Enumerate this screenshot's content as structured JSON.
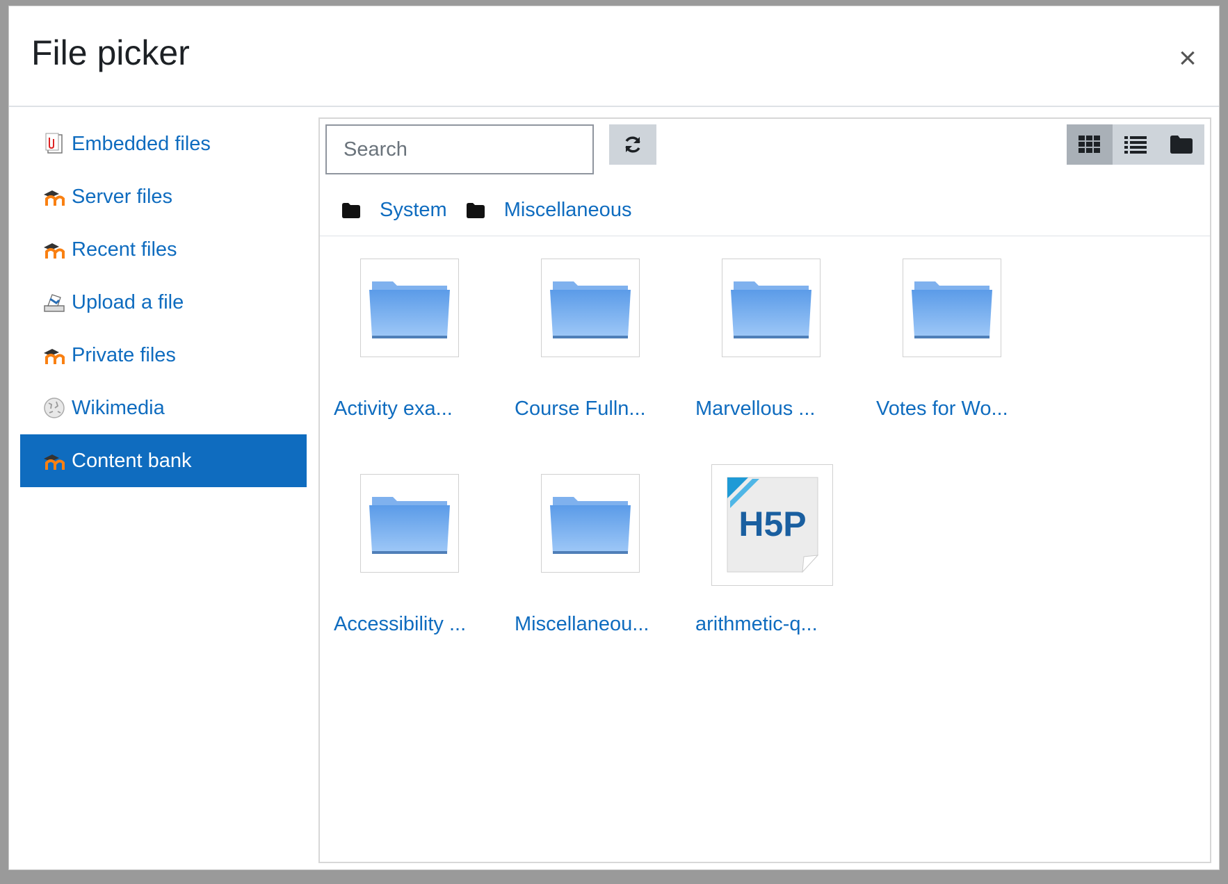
{
  "modal": {
    "title": "File picker",
    "close_symbol": "×"
  },
  "sidebar": {
    "items": [
      {
        "label": "Embedded files",
        "icon": "embedded-files-icon",
        "active": false
      },
      {
        "label": "Server files",
        "icon": "moodle-icon",
        "active": false
      },
      {
        "label": "Recent files",
        "icon": "moodle-icon",
        "active": false
      },
      {
        "label": "Upload a file",
        "icon": "upload-icon",
        "active": false
      },
      {
        "label": "Private files",
        "icon": "moodle-icon",
        "active": false
      },
      {
        "label": "Wikimedia",
        "icon": "wikimedia-icon",
        "active": false
      },
      {
        "label": "Content bank",
        "icon": "moodle-icon",
        "active": true
      }
    ]
  },
  "toolbar": {
    "search_placeholder": "Search",
    "refresh_icon": "refresh-icon",
    "views": [
      {
        "name": "icons-view",
        "active": true
      },
      {
        "name": "list-view",
        "active": false
      },
      {
        "name": "tree-view",
        "active": false
      }
    ]
  },
  "breadcrumb": [
    "System",
    "Miscellaneous"
  ],
  "files": [
    {
      "label": "Activity exa...",
      "type": "folder"
    },
    {
      "label": "Course Fulln...",
      "type": "folder"
    },
    {
      "label": "Marvellous ...",
      "type": "folder"
    },
    {
      "label": "Votes for Wo...",
      "type": "folder"
    },
    {
      "label": "Accessibility ...",
      "type": "folder"
    },
    {
      "label": "Miscellaneou...",
      "type": "folder"
    },
    {
      "label": "arithmetic-q...",
      "type": "h5p",
      "badge": "H5P"
    }
  ],
  "colors": {
    "link": "#0f6cbf",
    "active_bg": "#0f6cbf",
    "button_bg": "#ced4da",
    "moodle_orange": "#f98012"
  }
}
